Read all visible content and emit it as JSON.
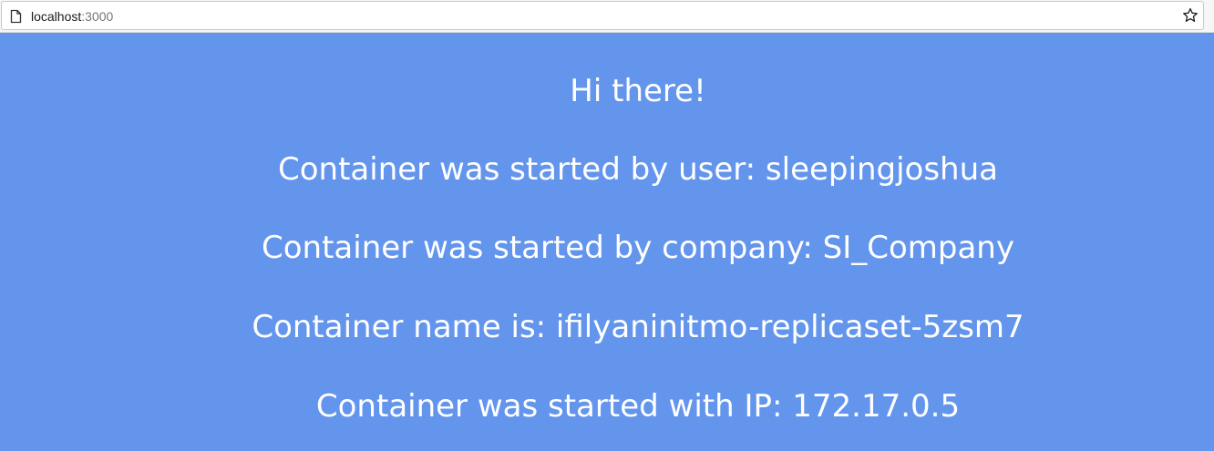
{
  "browser": {
    "url_host": "localhost",
    "url_port": ":3000",
    "icons": [
      "page-icon",
      "bookmark-star-icon"
    ]
  },
  "content": {
    "greeting": "Hi there!",
    "user_line": "Container was started by user: sleepingjoshua",
    "company_line": "Container was started by company: SI_Company",
    "name_line": "Container name is: ifilyaninitmo-replicaset-5zsm7",
    "ip_line": "Container was started with IP: 172.17.0.5"
  },
  "colors": {
    "background": "#6495ED",
    "text": "#FFFFFF"
  }
}
